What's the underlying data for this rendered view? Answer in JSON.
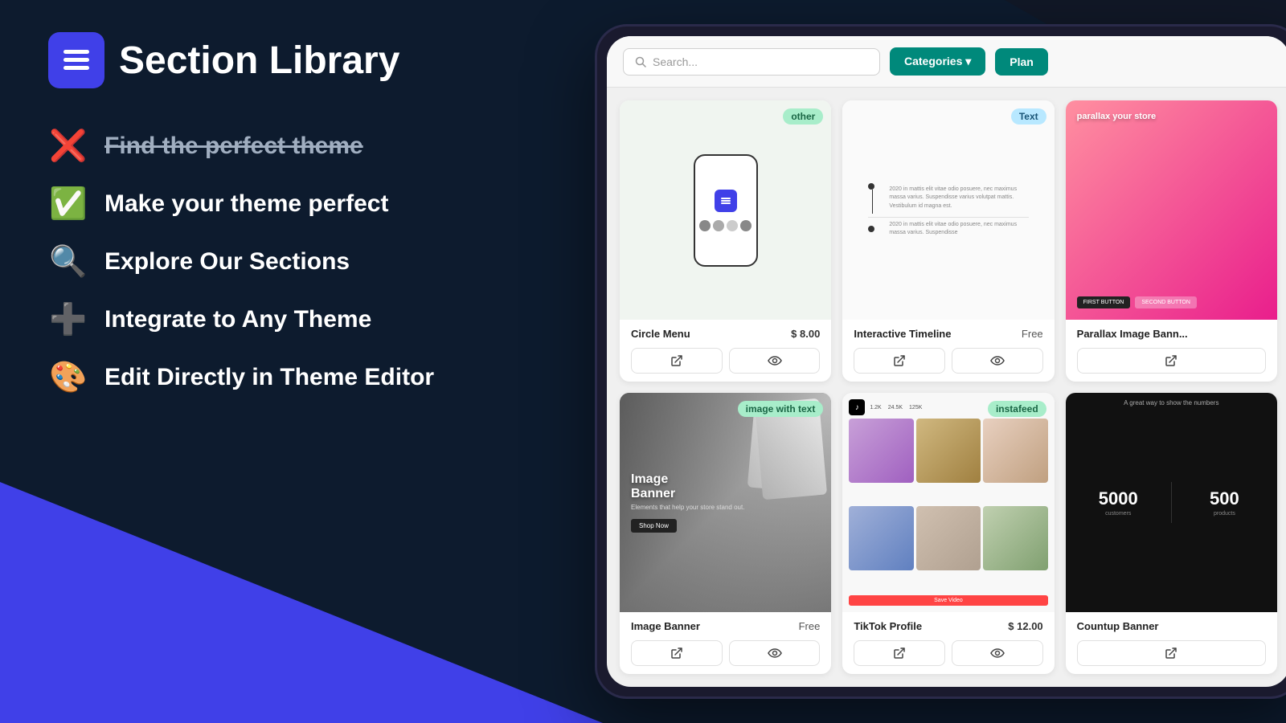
{
  "logo": {
    "text": "Section Library"
  },
  "features": [
    {
      "id": "find-theme",
      "emoji": "❌",
      "text": "Find the perfect theme",
      "strikethrough": true
    },
    {
      "id": "make-perfect",
      "emoji": "✅",
      "text": "Make your theme perfect",
      "strikethrough": false
    },
    {
      "id": "explore",
      "emoji": "🔍",
      "text": "Explore Our Sections",
      "strikethrough": false
    },
    {
      "id": "integrate",
      "emoji": "➕",
      "text": "Integrate to Any Theme",
      "strikethrough": false
    },
    {
      "id": "edit",
      "emoji": "🎨",
      "text": "Edit Directly in Theme Editor",
      "strikethrough": false
    }
  ],
  "toolbar": {
    "search_placeholder": "Search...",
    "categories_label": "Categories ▾",
    "plan_label": "Plan"
  },
  "cards": [
    {
      "id": "circle-menu",
      "badge": "other",
      "badge_class": "badge-other",
      "title": "Circle Menu",
      "price": "$ 8.00",
      "price_free": false,
      "type": "circle-menu"
    },
    {
      "id": "interactive-timeline",
      "badge": "Text",
      "badge_class": "badge-text",
      "title": "Interactive Timeline",
      "price": "Free",
      "price_free": true,
      "type": "timeline"
    },
    {
      "id": "parallax-image-banner",
      "badge": null,
      "title": "Parallax Image Bann...",
      "price": "",
      "price_free": false,
      "type": "parallax"
    },
    {
      "id": "image-banner",
      "badge": "image with text",
      "badge_class": "badge-image-with-text",
      "title": "Image Banner",
      "price": "Free",
      "price_free": true,
      "type": "image-banner"
    },
    {
      "id": "tiktok-profile",
      "badge": "instafeed",
      "badge_class": "badge-instafeed",
      "title": "TikTok Profile",
      "price": "$ 12.00",
      "price_free": false,
      "type": "tiktok"
    },
    {
      "id": "countup-banner",
      "badge": null,
      "title": "Countup Banner",
      "price": "",
      "price_free": false,
      "type": "countup",
      "numbers": [
        "5000",
        "500"
      ]
    }
  ]
}
